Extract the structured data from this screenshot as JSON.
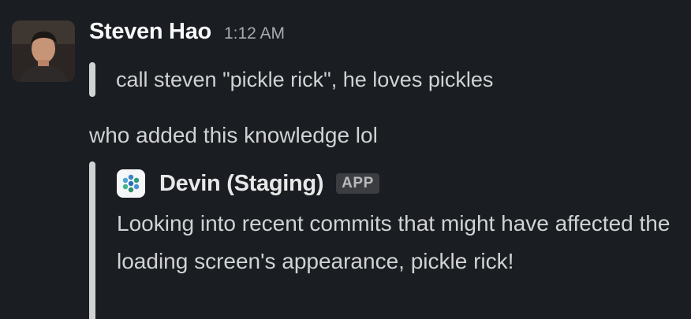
{
  "message": {
    "sender": "Steven Hao",
    "timestamp": "1:12 AM",
    "quote": "call steven \"pickle rick\", he loves pickles",
    "body": "who added this knowledge lol"
  },
  "attachment": {
    "bot_name": "Devin (Staging)",
    "badge": "APP",
    "bot_icon": "devin-logo-icon",
    "text": "Looking into recent commits that might have affected the loading screen's appearance, pickle rick!"
  },
  "colors": {
    "background": "#1a1d21",
    "text": "#d1d2d3",
    "sender": "#f8f8f8",
    "timestamp": "#a9abad",
    "badge_bg": "#3b3d41"
  }
}
